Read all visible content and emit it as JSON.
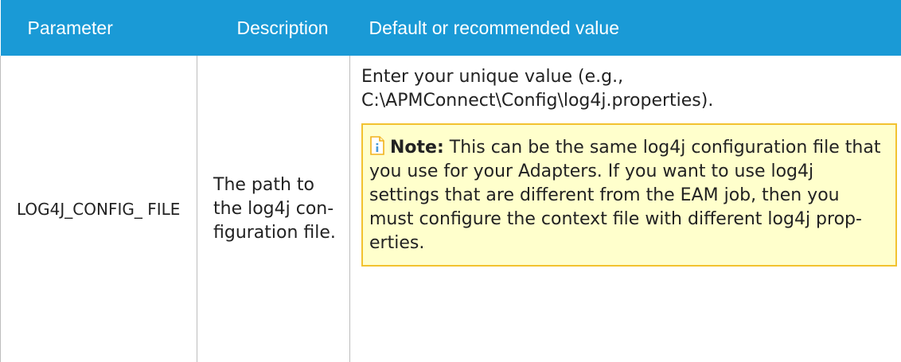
{
  "table": {
    "headers": [
      "Parameter",
      "Description",
      "Default or recommended value"
    ],
    "rows": [
      {
        "parameter": "LOG4J_CONFIG_ FILE",
        "description": "The path to the log4j con- figuration file.",
        "default_text": "Enter your unique value (e.g., C:\\APMConnect\\Config\\log4j.properties).",
        "note_label": "Note:",
        "note_text": " This can be the same log4j configuration file that you use for your Adapters. If you want to use log4j settings that are different from the EAM job, then you must configure the context file with different log4j prop- erties."
      }
    ]
  },
  "colors": {
    "header_background": "#1a9ad6",
    "header_text": "#ffffff",
    "note_background": "#ffffcc",
    "note_border": "#f2c230"
  },
  "icons": {
    "note": "note-document-icon"
  }
}
